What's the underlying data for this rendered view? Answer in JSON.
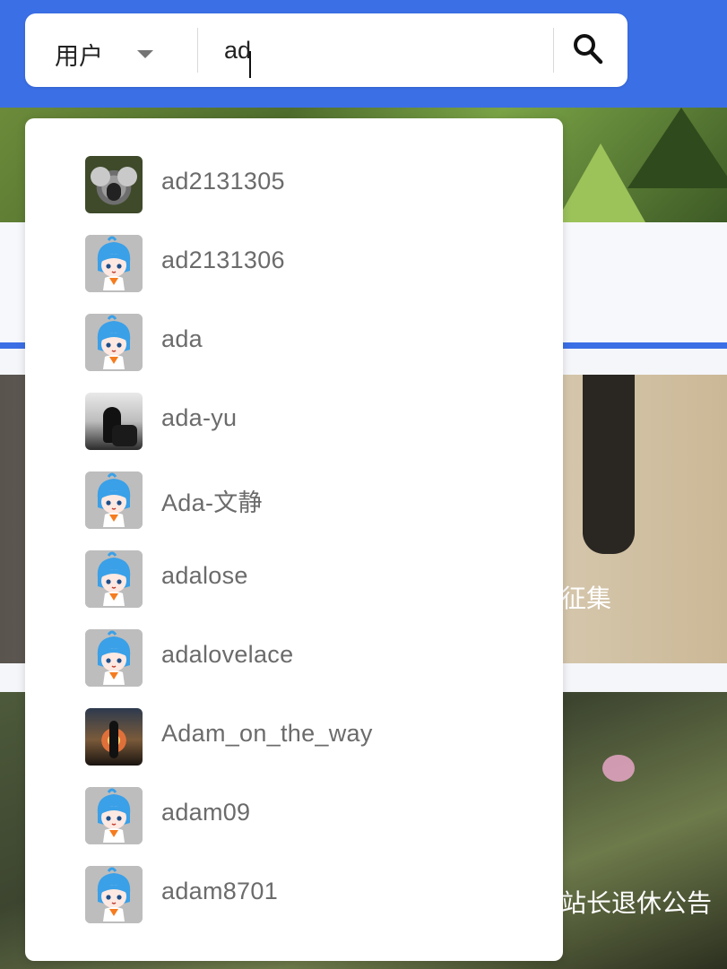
{
  "search": {
    "scope": "用户",
    "query": "ad"
  },
  "suggestions": [
    {
      "name": "ad2131305",
      "avatar": "koala"
    },
    {
      "name": "ad2131306",
      "avatar": "default-mascot"
    },
    {
      "name": "ada",
      "avatar": "default-mascot"
    },
    {
      "name": "ada-yu",
      "avatar": "bw-photo"
    },
    {
      "name": "Ada-文静",
      "avatar": "default-mascot"
    },
    {
      "name": "adalose",
      "avatar": "default-mascot"
    },
    {
      "name": "adalovelace",
      "avatar": "default-mascot"
    },
    {
      "name": "Adam_on_the_way",
      "avatar": "game-art"
    },
    {
      "name": "adam09",
      "avatar": "default-mascot"
    },
    {
      "name": "adam8701",
      "avatar": "default-mascot"
    }
  ],
  "background": {
    "card1_caption": "征集",
    "card2_caption": "站长退休公告"
  },
  "colors": {
    "header": "#3b6fe6",
    "username": "#6b6b6b"
  }
}
